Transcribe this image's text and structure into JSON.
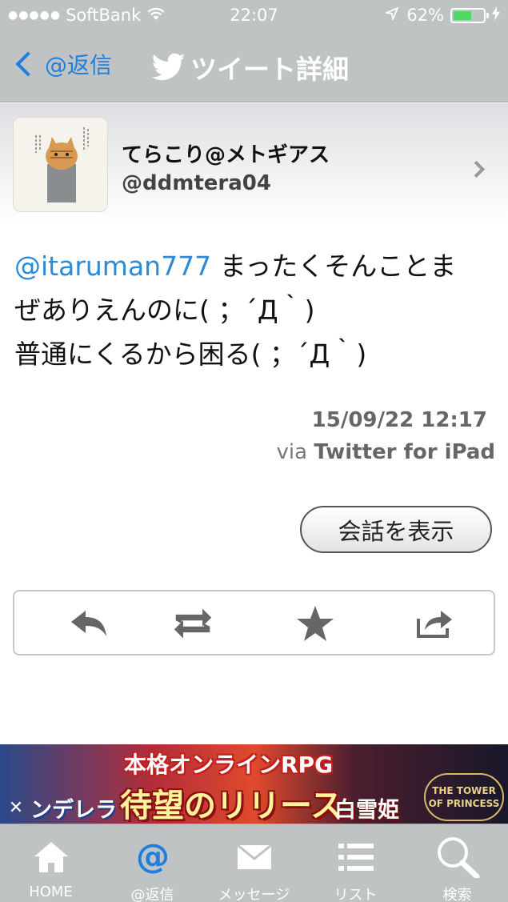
{
  "status_bar": {
    "carrier": "SoftBank",
    "time": "22:07",
    "battery_percent": "62%",
    "battery_level": 0.62
  },
  "nav": {
    "back_label": "@返信",
    "title": "ツイート詳細"
  },
  "profile": {
    "name": "てらこり@メトギアス",
    "handle": "@ddmtera04"
  },
  "tweet": {
    "mention": "@itaruman777",
    "text_line1": " まったくそんことま",
    "text_line2": "ぜありえんのに( ；´Д｀)",
    "text_line3": "普通にくるから困る( ；´Д｀)",
    "date": "15/09/22 12:17",
    "via_prefix": "via ",
    "via_client": "Twitter for iPad"
  },
  "conversation_button": "会話を表示",
  "actions": [
    "reply-icon",
    "retweet-icon",
    "favorite-icon",
    "share-icon"
  ],
  "ad": {
    "headline": "本格オンラインRPG",
    "main": "待望のリリース",
    "left_text": "ンデレラ",
    "right_text": "白雪姫",
    "logo_text": "THE TOWER OF PRINCESS"
  },
  "tab_bar": {
    "items": [
      {
        "label": "HOME",
        "icon": "home-icon"
      },
      {
        "label": "@返信",
        "icon": "at-icon"
      },
      {
        "label": "メッセージ",
        "icon": "mail-icon"
      },
      {
        "label": "リスト",
        "icon": "list-icon"
      },
      {
        "label": "検索",
        "icon": "search-icon"
      }
    ]
  },
  "colors": {
    "accent": "#1e7fe0",
    "bar_bg": "#bfc3c4",
    "mention": "#2b8bd6"
  }
}
